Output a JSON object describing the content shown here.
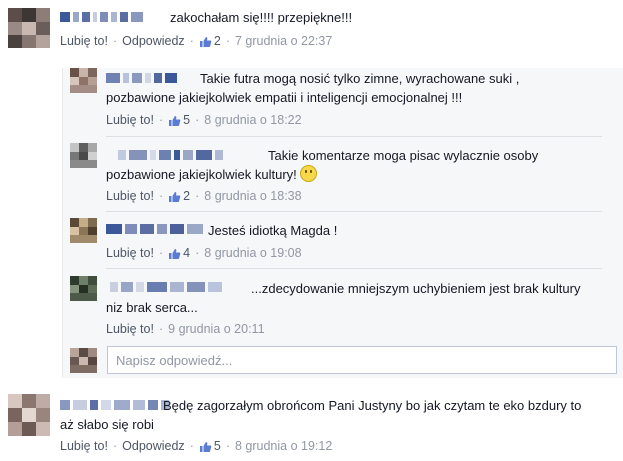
{
  "comments": [
    {
      "text": "zakochałam się!!!! przepiękne!!!",
      "like_label": "Lubię to!",
      "reply_label": "Odpowiedz",
      "likes": "2",
      "date": "7 grudnia o 22:37"
    },
    {
      "text": "Będę zagorzałym obrońcom Pani Justyny bo jak czytam te eko bzdury to aż słabo się robi",
      "like_label": "Lubię to!",
      "reply_label": "Odpowiedz",
      "likes": "5",
      "date": "8 grudnia o 19:12"
    }
  ],
  "replies": [
    {
      "text": "Takie futra mogą nosić tylko zimne, wyrachowane suki , pozbawione jakiejkolwiek empatii i inteligencji emocjonalnej !!!",
      "like_label": "Lubię to!",
      "likes": "5",
      "date": "8 grudnia o 18:22"
    },
    {
      "text": "Takie komentarze moga pisac wylacznie osoby pozbawione jakiejkolwiek kultury!",
      "like_label": "Lubię to!",
      "likes": "2",
      "date": "8 grudnia o 18:38",
      "emoji": "smile-emoji"
    },
    {
      "text": "Jesteś idiotką Magda !",
      "like_label": "Lubię to!",
      "likes": "4",
      "date": "8 grudnia o 19:08"
    },
    {
      "text": "...zdecydowanie mniejszym uchybieniem jest brak kultury niz brak serca...",
      "like_label": "Lubię to!",
      "date": "9 grudnia o 20:11"
    }
  ],
  "reply_input": {
    "placeholder": "Napisz odpowiedź..."
  },
  "colors": {
    "link": "#4e5665",
    "meta": "#9197a3",
    "reply_bg": "#f6f7f9",
    "mosaic_blue": "#3b5998"
  },
  "icons": {
    "like": "thumbs-up-icon"
  }
}
